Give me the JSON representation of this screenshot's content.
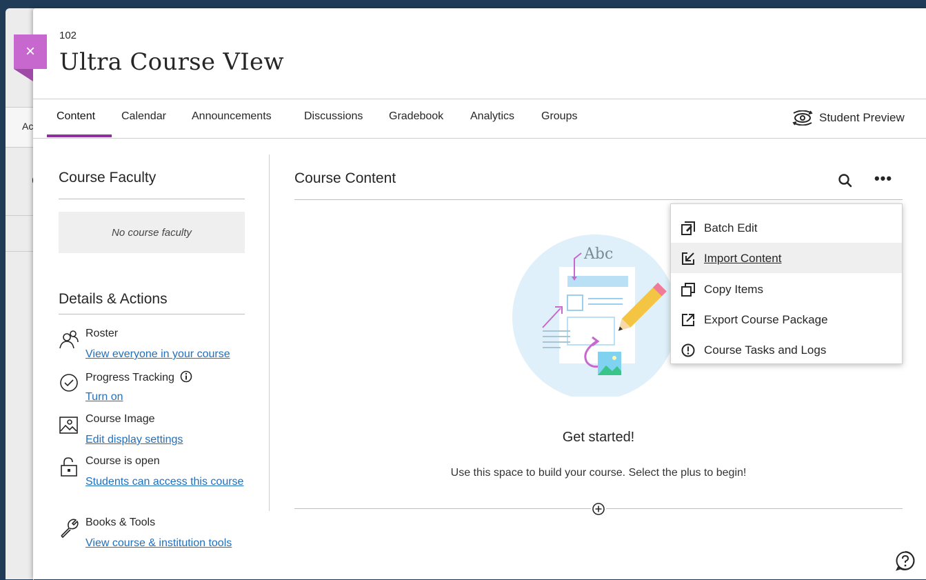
{
  "course": {
    "code": "102",
    "title": "Ultra Course VIew",
    "close_label": "×"
  },
  "background": {
    "tab_fragment": "Ac",
    "heading_fragment": "C"
  },
  "tabs": [
    {
      "label": "Content",
      "active": true
    },
    {
      "label": "Calendar"
    },
    {
      "label": "Announcements"
    },
    {
      "label": "Discussions"
    },
    {
      "label": "Gradebook"
    },
    {
      "label": "Analytics"
    },
    {
      "label": "Groups"
    }
  ],
  "student_preview": {
    "label": "Student Preview",
    "icon": "eye-rotate-icon"
  },
  "faculty": {
    "title": "Course Faculty",
    "empty_text": "No course faculty"
  },
  "details": {
    "title": "Details & Actions",
    "items": [
      {
        "icon": "roster-icon",
        "label": "Roster",
        "link": "View everyone in your course"
      },
      {
        "icon": "progress-check-icon",
        "label": "Progress Tracking",
        "info_icon": "info-icon",
        "link": "Turn on"
      },
      {
        "icon": "image-icon",
        "label": "Course Image",
        "link": "Edit display settings"
      },
      {
        "icon": "unlock-icon",
        "label": "Course is open",
        "link": "Students can access this course"
      },
      {
        "icon": "wrench-icon",
        "label": "Books & Tools",
        "link": "View course & institution tools"
      }
    ]
  },
  "content": {
    "title": "Course Content",
    "search_icon": "search-icon",
    "more_icon": "more-options-icon",
    "more_label": "•••",
    "illustration_text": "Abc",
    "get_started": "Get started!",
    "hint": "Use this space to build your course. Select the plus to begin!"
  },
  "menu": {
    "items": [
      {
        "label": "Batch Edit",
        "icon": "batch-edit-icon"
      },
      {
        "label": "Import Content",
        "icon": "import-icon",
        "hovered": true
      },
      {
        "label": "Copy Items",
        "icon": "copy-icon"
      },
      {
        "label": "Export Course Package",
        "icon": "export-icon"
      },
      {
        "label": "Course Tasks and Logs",
        "icon": "alert-icon"
      }
    ]
  },
  "colors": {
    "accent_purple": "#8d2fa0",
    "close_button": "#c768cf",
    "link_blue": "#1f6fbf",
    "frame": "#1f3b58"
  }
}
